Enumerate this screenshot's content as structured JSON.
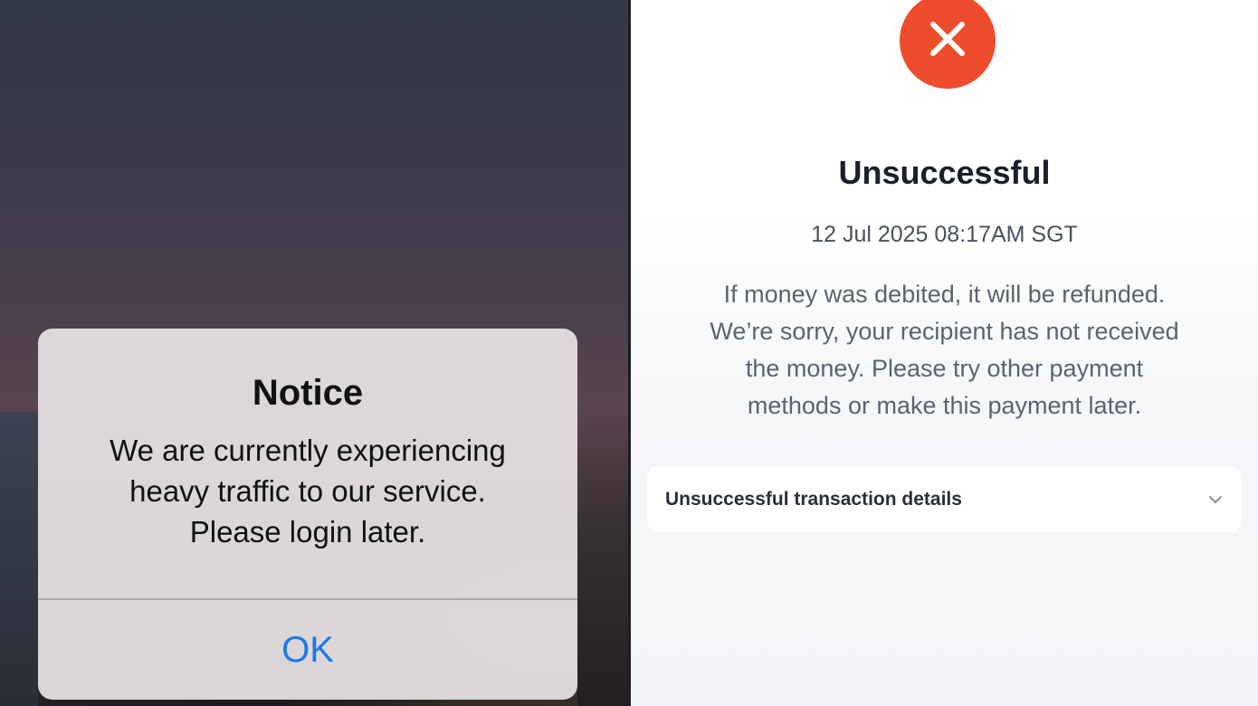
{
  "notice_alert": {
    "title": "Notice",
    "message_lines": [
      "We are currently experiencing",
      "heavy traffic to our service.",
      "Please login later."
    ],
    "ok_label": "OK"
  },
  "transaction_status": {
    "icon": "close-icon",
    "title": "Unsuccessful",
    "timestamp": "12 Jul 2025 08:17AM SGT",
    "message_lines": [
      "If money was debited, it will be refunded.",
      "We’re sorry, your recipient has not received",
      "the money. Please try other payment",
      "methods or make this payment later."
    ],
    "details_label": "Unsuccessful transaction details",
    "details_icon": "chevron-down-icon"
  },
  "colors": {
    "error_red": "#ee4c2c",
    "link_blue": "#1a7ae6"
  }
}
